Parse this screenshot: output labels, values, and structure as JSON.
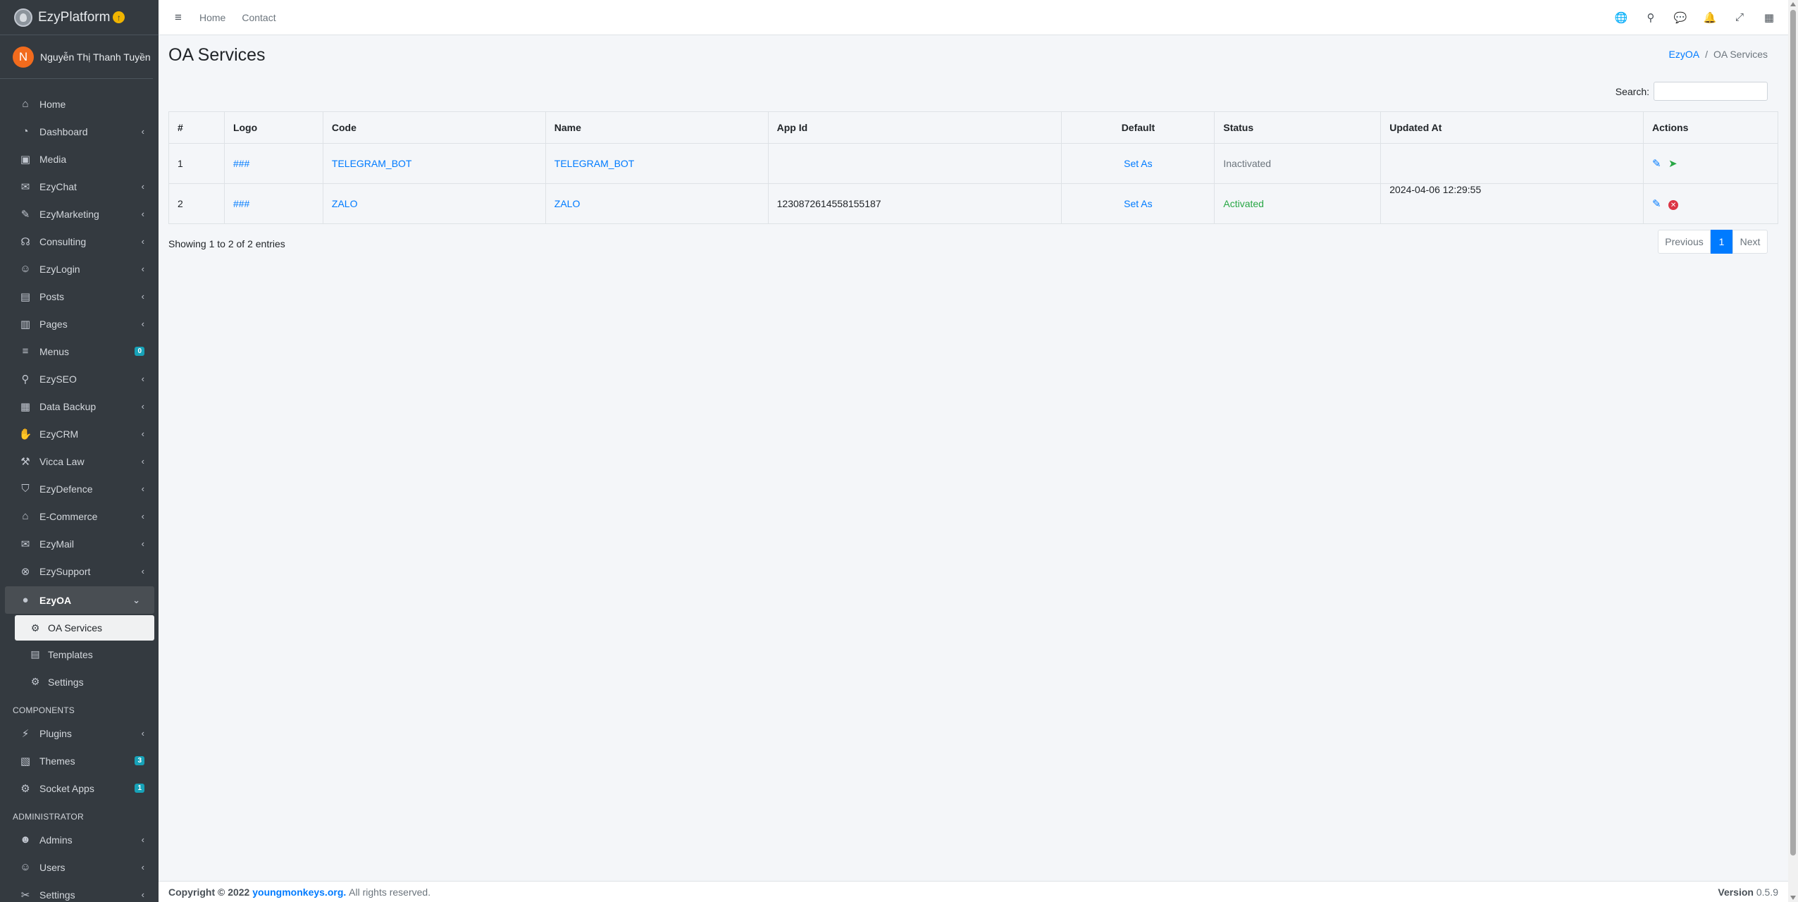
{
  "brand": {
    "name": "EzyPlatform",
    "badge": "↑"
  },
  "user": {
    "initial": "N",
    "name": "Nguyễn Thị Thanh Tuyền"
  },
  "sidebar": {
    "items": [
      {
        "label": "Home",
        "icon": "home-icon",
        "glyph": "⌂",
        "chevron": false
      },
      {
        "label": "Dashboard",
        "icon": "dashboard-icon",
        "glyph": "◔",
        "chevron": true
      },
      {
        "label": "Media",
        "icon": "media-icon",
        "glyph": "▣",
        "chevron": false
      },
      {
        "label": "EzyChat",
        "icon": "chat-icon",
        "glyph": "✉",
        "chevron": true
      },
      {
        "label": "EzyMarketing",
        "icon": "megaphone-icon",
        "glyph": "✎",
        "chevron": true
      },
      {
        "label": "Consulting",
        "icon": "headset-icon",
        "glyph": "☊",
        "chevron": true
      },
      {
        "label": "EzyLogin",
        "icon": "user-lock-icon",
        "glyph": "☺",
        "chevron": true
      },
      {
        "label": "Posts",
        "icon": "newspaper-icon",
        "glyph": "▤",
        "chevron": true
      },
      {
        "label": "Pages",
        "icon": "pages-icon",
        "glyph": "▥",
        "chevron": true
      },
      {
        "label": "Menus",
        "icon": "bars-icon",
        "glyph": "≡",
        "badge": "0"
      },
      {
        "label": "EzySEO",
        "icon": "search-plus-icon",
        "glyph": "⚲",
        "chevron": true
      },
      {
        "label": "Data Backup",
        "icon": "database-icon",
        "glyph": "▦",
        "chevron": true
      },
      {
        "label": "EzyCRM",
        "icon": "handshake-icon",
        "glyph": "✋",
        "chevron": true
      },
      {
        "label": "Vicca Law",
        "icon": "gavel-icon",
        "glyph": "⚒",
        "chevron": true
      },
      {
        "label": "EzyDefence",
        "icon": "shield-icon",
        "glyph": "⛉",
        "chevron": true
      },
      {
        "label": "E-Commerce",
        "icon": "store-icon",
        "glyph": "⌂",
        "chevron": true
      },
      {
        "label": "EzyMail",
        "icon": "envelope-icon",
        "glyph": "✉",
        "chevron": true
      },
      {
        "label": "EzySupport",
        "icon": "lifebuoy-icon",
        "glyph": "⊗",
        "chevron": true
      }
    ],
    "active_parent": {
      "label": "EzyOA",
      "icon": "circle-icon",
      "glyph": "●",
      "chevron": "⌄"
    },
    "sub_items": [
      {
        "label": "OA Services",
        "icon": "cogs-icon",
        "glyph": "⚙",
        "active": true
      },
      {
        "label": "Templates",
        "icon": "table-icon",
        "glyph": "▤"
      },
      {
        "label": "Settings",
        "icon": "cogs-icon",
        "glyph": "⚙"
      }
    ],
    "components_header": "COMPONENTS",
    "components": [
      {
        "label": "Plugins",
        "icon": "plug-icon",
        "glyph": "⚡",
        "chevron": true
      },
      {
        "label": "Themes",
        "icon": "themes-icon",
        "glyph": "▧",
        "badge": "3"
      },
      {
        "label": "Socket Apps",
        "icon": "cubes-icon",
        "glyph": "⚙",
        "badge": "1"
      }
    ],
    "admin_header": "ADMINISTRATOR",
    "admin": [
      {
        "label": "Admins",
        "icon": "user-circle-icon",
        "glyph": "☻",
        "chevron": true
      },
      {
        "label": "Users",
        "icon": "users-icon",
        "glyph": "☺",
        "chevron": true
      },
      {
        "label": "Settings",
        "icon": "tools-icon",
        "glyph": "✂",
        "chevron": true
      }
    ]
  },
  "topbar": {
    "menu_glyph": "≡",
    "links": [
      "Home",
      "Contact"
    ],
    "icons": [
      {
        "name": "globe-icon",
        "glyph": "🌐"
      },
      {
        "name": "search-icon",
        "glyph": "⚲"
      },
      {
        "name": "messages-icon",
        "glyph": "💬"
      },
      {
        "name": "bell-icon",
        "glyph": "🔔"
      },
      {
        "name": "expand-icon",
        "glyph": "⤢"
      },
      {
        "name": "apps-icon",
        "glyph": "▦"
      }
    ]
  },
  "page": {
    "title": "OA Services",
    "breadcrumb": {
      "parent": "EzyOA",
      "separator": "/",
      "current": "OA Services"
    },
    "search_label": "Search:",
    "search_value": ""
  },
  "table": {
    "headers": [
      "#",
      "Logo",
      "Code",
      "Name",
      "App Id",
      "Default",
      "Status",
      "Updated At",
      "Actions"
    ],
    "rows": [
      {
        "num": "1",
        "logo": "###",
        "code": "TELEGRAM_BOT",
        "name": "TELEGRAM_BOT",
        "app_id": "",
        "default": "Set As",
        "status": "Inactivated",
        "updated_at": "",
        "action2": "send"
      },
      {
        "num": "2",
        "logo": "###",
        "code": "ZALO",
        "name": "ZALO",
        "app_id": "1230872614558155187",
        "default": "Set As",
        "status": "Activated",
        "updated_at": "2024-04-06 12:29:55",
        "action2": "delete"
      }
    ]
  },
  "entries_info": "Showing 1 to 2 of 2 entries",
  "pager": {
    "prev": "Previous",
    "page": "1",
    "next": "Next"
  },
  "footer": {
    "copyright": "Copyright © 2022",
    "link": "youngmonkeys.org.",
    "rights": "All rights reserved.",
    "version_label": "Version",
    "version": "0.5.9"
  },
  "colors": {
    "sidebar_bg": "#343a40",
    "primary": "#007bff",
    "success": "#28a745",
    "danger": "#dc3545",
    "info": "#17a2b8"
  }
}
